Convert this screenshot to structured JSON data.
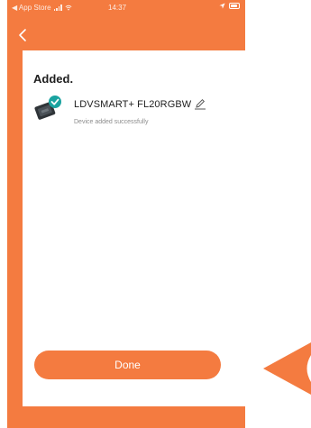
{
  "status_bar": {
    "back_app": "◀ App Store",
    "time": "14:37"
  },
  "page": {
    "title": "Added.",
    "device_name": "LDVSMART+ FL20RGBW",
    "device_status": "Device added successfully",
    "done_label": "Done"
  },
  "icons": {
    "back": "chevron-left-icon",
    "edit": "pencil-icon",
    "device_check": "check-circle-icon",
    "pointer": "arrow-pointer-icon"
  },
  "colors": {
    "accent": "#f47b40",
    "check": "#1aa3a0",
    "text": "#1e1e1e",
    "secondary": "#8c8c8c"
  }
}
